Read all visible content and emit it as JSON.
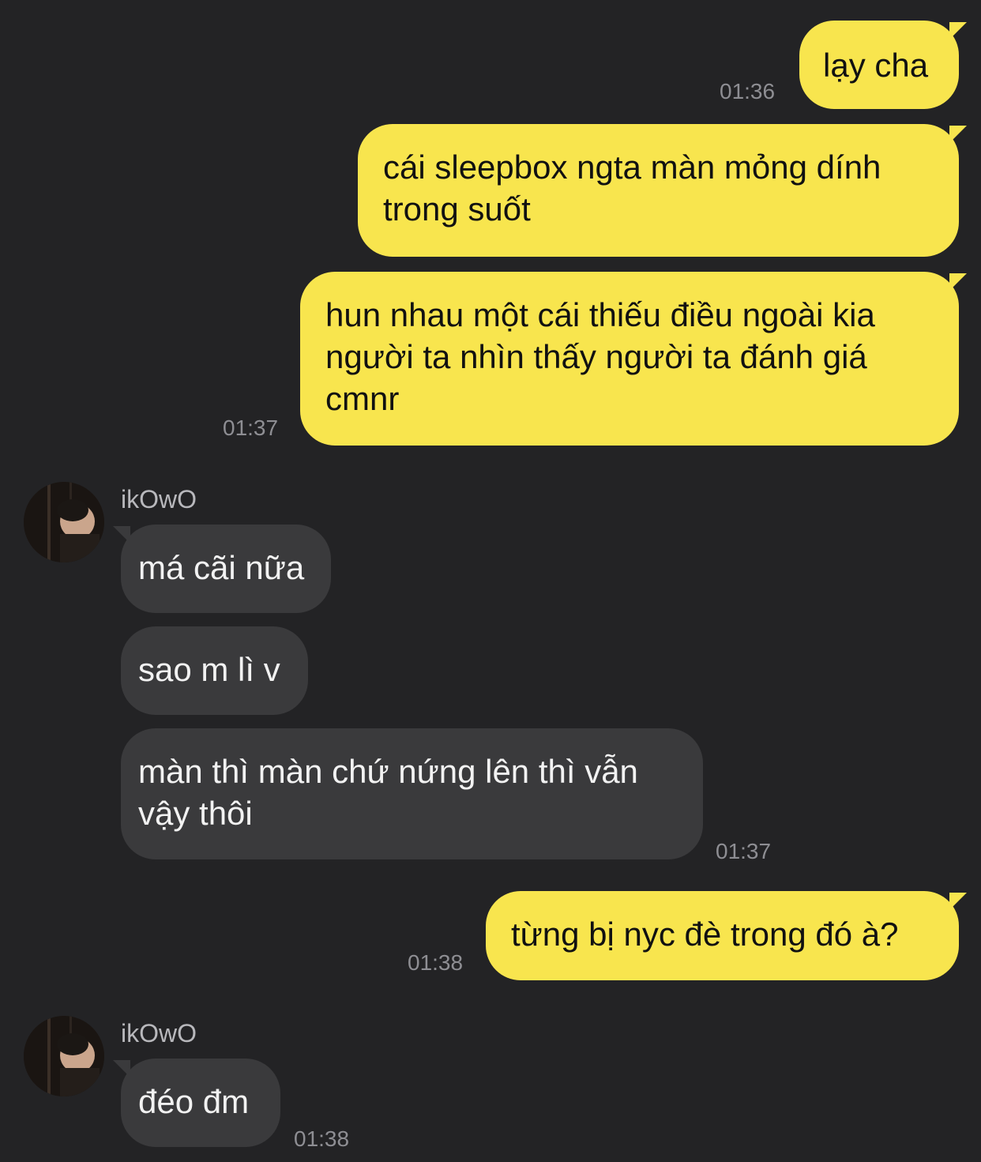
{
  "messages": [
    {
      "text": "lạy cha",
      "time": "01:36"
    },
    {
      "text": "cái sleepbox ngta màn mỏng dính trong suốt"
    },
    {
      "text": "hun nhau một cái thiếu điều ngoài kia người ta nhìn thấy người ta đánh giá cmnr",
      "time": "01:37"
    },
    {
      "sender": "ikOwO",
      "text": "má cãi nữa"
    },
    {
      "text": "sao m lì v"
    },
    {
      "text": "màn thì màn chứ nứng lên thì vẫn vậy thôi",
      "time": "01:37"
    },
    {
      "text": "từng bị nyc đè trong đó à?",
      "time": "01:38"
    },
    {
      "sender": "ikOwO",
      "text": "đéo đm",
      "time": "01:38"
    }
  ]
}
